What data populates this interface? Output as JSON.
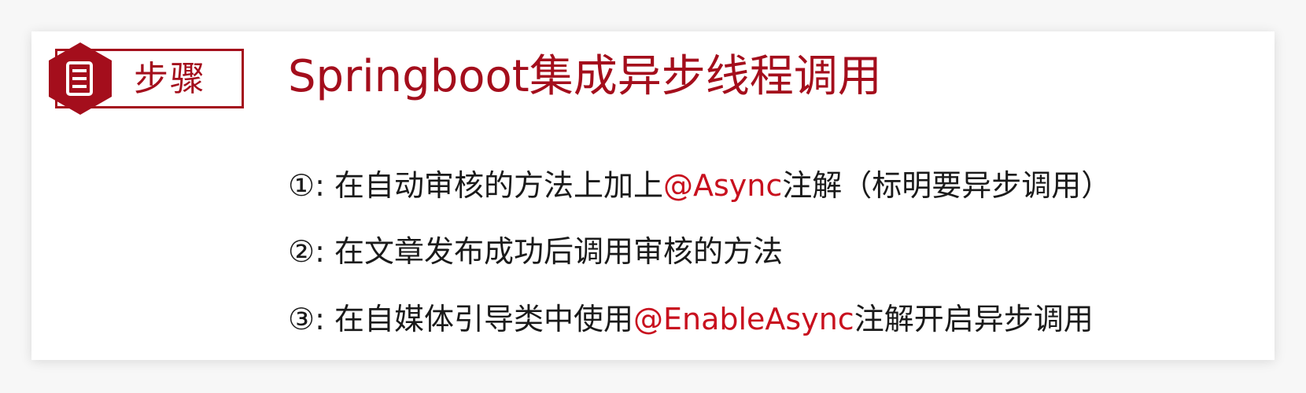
{
  "badge": {
    "label": "步骤",
    "icon": "document-icon",
    "color": "#a40e1c"
  },
  "title": "Springboot集成异步线程调用",
  "steps": [
    {
      "marker": "①",
      "sep": ": ",
      "pre": "在自动审核的方法上加上",
      "highlight": "@Async",
      "post": "注解（标明要异步调用）"
    },
    {
      "marker": "②",
      "sep": ": ",
      "pre": "在文章发布成功后调用审核的方法",
      "highlight": "",
      "post": ""
    },
    {
      "marker": "③",
      "sep": ": ",
      "pre": "在自媒体引导类中使用",
      "highlight": "@EnableAsync",
      "post": "注解开启异步调用"
    }
  ],
  "colors": {
    "accent": "#a40e1c",
    "highlight": "#c8101e",
    "text": "#1a1a1a"
  }
}
